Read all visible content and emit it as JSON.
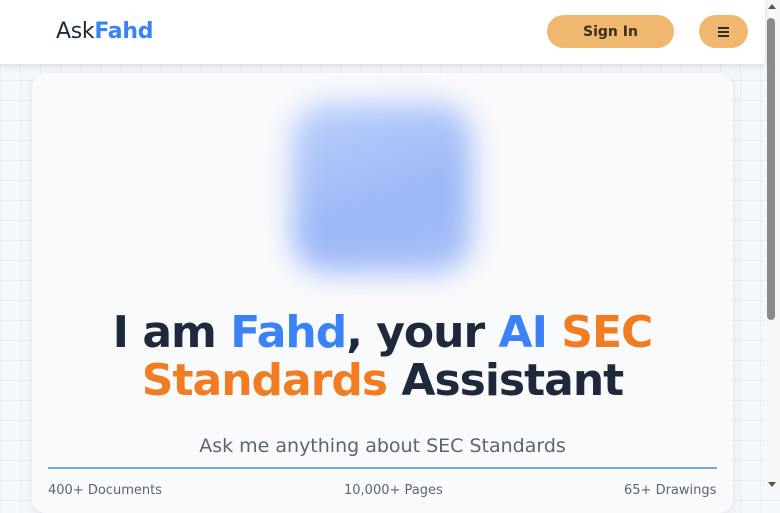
{
  "header": {
    "logo_part1": "Ask",
    "logo_part2": "Fahd",
    "signin_label": "Sign In",
    "menu_icon": "hamburger-icon"
  },
  "hero": {
    "headline": {
      "p1": "I am ",
      "p2": "Fahd",
      "p3": ", your ",
      "p4": "AI",
      "p5": "SEC",
      "p6": "Standards",
      "p7": " Assistant"
    },
    "subtitle": "Ask me anything about SEC Standards",
    "stats": [
      "400+ Documents",
      "10,000+ Pages",
      "65+ Drawings"
    ]
  },
  "colors": {
    "accent_blue": "#3b82f6",
    "accent_orange": "#f17c22",
    "button_bg": "#f0b86e"
  }
}
